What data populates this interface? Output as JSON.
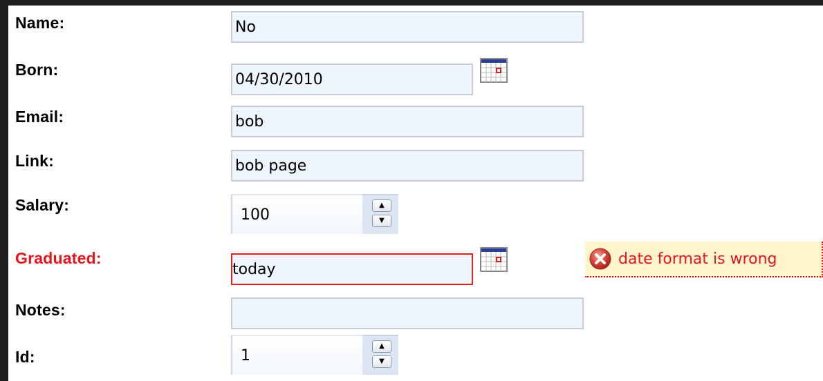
{
  "form": {
    "name": {
      "label": "Name:",
      "value": "No"
    },
    "born": {
      "label": "Born:",
      "value": "04/30/2010"
    },
    "email": {
      "label": "Email:",
      "value": "bob"
    },
    "link": {
      "label": "Link:",
      "value": "bob page"
    },
    "salary": {
      "label": "Salary:",
      "value": "100"
    },
    "graduated": {
      "label": "Graduated:",
      "value": "today",
      "error": "date format is wrong"
    },
    "notes": {
      "label": "Notes:",
      "value": ""
    },
    "id": {
      "label": "Id:",
      "value": "1"
    }
  },
  "colors": {
    "error": "#e8141c",
    "field_background": "#eef5fd",
    "tooltip_background": "#fff5cc"
  },
  "icons": {
    "calendar": "calendar-icon",
    "spin_up": "spin-up-arrow-icon",
    "spin_down": "spin-down-arrow-icon",
    "error": "error-x-icon"
  }
}
